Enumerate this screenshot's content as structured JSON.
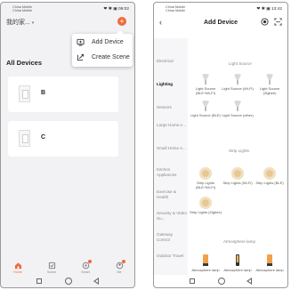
{
  "left_screen": {
    "status": {
      "carrier_1": "China Mobile",
      "carrier_2": "China Mobile",
      "time_text": "❤ ✱ ▣ 09:02"
    },
    "header": {
      "home_name": "我的家",
      "caret": "▾",
      "add_symbol": "+"
    },
    "section_title": "All Devices",
    "devices": [
      {
        "name": "B"
      },
      {
        "name": "C"
      }
    ],
    "menu": [
      {
        "label": "Add Device",
        "icon": "add-device-icon"
      },
      {
        "label": "Create Scene",
        "icon": "create-scene-icon"
      }
    ],
    "tabs": [
      {
        "label": "Home",
        "icon": "home-icon",
        "active": true
      },
      {
        "label": "Scene",
        "icon": "scene-icon",
        "active": false
      },
      {
        "label": "Smart",
        "icon": "smart-icon",
        "active": false
      },
      {
        "label": "Me",
        "icon": "me-icon",
        "active": false
      }
    ]
  },
  "right_screen": {
    "status": {
      "carrier_1": "China Mobile",
      "carrier_2": "China Mobile",
      "time_text": "❤ ✱ ▣ 13:42"
    },
    "header": {
      "back": "‹",
      "title": "Add Device"
    },
    "categories": [
      {
        "label": "Electrical",
        "active": false
      },
      {
        "label": "Lighting",
        "active": true
      },
      {
        "label": "Sensors",
        "active": false
      },
      {
        "label": "Large Home A...",
        "active": false
      },
      {
        "label": "Small Home A...",
        "active": false
      },
      {
        "label": "Kitchen Appliances",
        "active": false
      },
      {
        "label": "Exercise & Health",
        "active": false
      },
      {
        "label": "Security & Video Su...",
        "active": false
      },
      {
        "label": "Gateway Control",
        "active": false
      },
      {
        "label": "Outdoor Travel",
        "active": false
      }
    ],
    "groups": {
      "light_source": {
        "title": "Light Source",
        "items": [
          {
            "label": "Light Source (BLE+Wi-Fi)"
          },
          {
            "label": "Light Source (Wi-Fi)"
          },
          {
            "label": "Light Source (Zigbee)"
          },
          {
            "label": "Light Source (BLE)"
          },
          {
            "label": "Light Source (other)"
          }
        ]
      },
      "strip_lights": {
        "title": "Strip Lights",
        "items": [
          {
            "label": "Strip Lights (BLE+Wi-Fi)"
          },
          {
            "label": "Strip Lights (Wi-Fi)"
          },
          {
            "label": "Strip Lights (BLE)"
          },
          {
            "label": "Strip Lights (Zigbee)"
          }
        ]
      },
      "atmosphere": {
        "title": "Atmosphere lamp",
        "items": [
          {
            "label": "Atmosphere lamp"
          },
          {
            "label": "Atmosphere lamp"
          },
          {
            "label": "Atmosphere lamp"
          }
        ]
      }
    }
  },
  "colors": {
    "accent": "#f06a3a",
    "card": "#ffffff",
    "page": "#f2f2f4"
  }
}
